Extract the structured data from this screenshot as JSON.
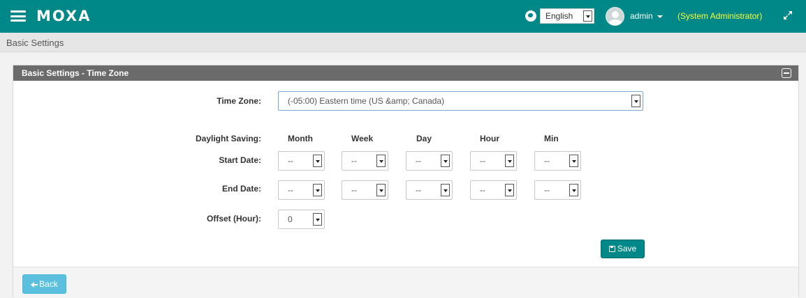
{
  "header": {
    "logo": "MOXA",
    "language": "English",
    "username": "admin",
    "role": "(System Administrator)",
    "colors": {
      "bar": "#008787",
      "role": "#ffff3a"
    },
    "icons": [
      "menu-icon",
      "globe-icon",
      "user-avatar-icon",
      "expand-icon"
    ]
  },
  "breadcrumb": "Basic Settings",
  "panel": {
    "title": "Basic Settings - Time Zone",
    "timezone_label": "Time Zone:",
    "timezone_value": "(-05:00) Eastern time (US &amp; Canada)",
    "daylight_label": "Daylight Saving:",
    "columns": {
      "month": "Month",
      "week": "Week",
      "day": "Day",
      "hour": "Hour",
      "min": "Min"
    },
    "start_label": "Start Date:",
    "end_label": "End Date:",
    "start": {
      "month": "--",
      "week": "--",
      "day": "--",
      "hour": "--",
      "min": "--"
    },
    "end": {
      "month": "--",
      "week": "--",
      "day": "--",
      "hour": "--",
      "min": "--"
    },
    "offset_label": "Offset (Hour):",
    "offset_value": "0",
    "save_label": "Save"
  },
  "footer": {
    "back_label": "Back"
  }
}
